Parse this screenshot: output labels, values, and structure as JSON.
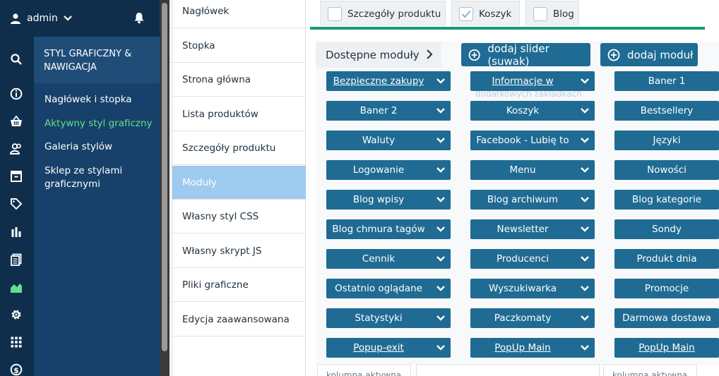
{
  "user": {
    "name": "admin"
  },
  "sidebar_icons": [
    "search-icon",
    "info-icon",
    "basket-icon",
    "users-icon",
    "box-icon",
    "tag-icon",
    "stats-icon",
    "pages-icon",
    "graphics-icon",
    "gear-icon",
    "apps-icon",
    "dollar-icon"
  ],
  "section": {
    "title": "STYL GRAFICZNY & NAWIGACJA",
    "items": [
      {
        "label": "Nagłówek i stopka",
        "active": false
      },
      {
        "label": "Aktywny styl graficzny",
        "active": true
      },
      {
        "label": "Galeria stylów",
        "active": false
      },
      {
        "label": "Sklep ze stylami graficznymi",
        "active": false
      }
    ]
  },
  "page_menu": [
    {
      "label": "Nagłówek",
      "active": false
    },
    {
      "label": "Stopka",
      "active": false
    },
    {
      "label": "Strona główna",
      "active": false
    },
    {
      "label": "Lista produktów",
      "active": false
    },
    {
      "label": "Szczegóły produktu",
      "active": false
    },
    {
      "label": "Moduły",
      "active": true
    },
    {
      "label": "Własny styl CSS",
      "active": false
    },
    {
      "label": "Własny skrypt JS",
      "active": false
    },
    {
      "label": "Pliki graficzne",
      "active": false
    },
    {
      "label": "Edycja zaawansowana",
      "active": false
    }
  ],
  "tabs": [
    {
      "label": "Szczegóły produktu",
      "checked": false
    },
    {
      "label": "Koszyk",
      "checked": true
    },
    {
      "label": "Blog",
      "checked": false
    }
  ],
  "available_modules_label": "Dostępne moduły",
  "actions": {
    "add_slider": "dodaj slider (suwak)",
    "add_module": "dodaj moduł"
  },
  "modules": {
    "col1": [
      {
        "label": "Bezpieczne zakupy",
        "underline": true
      },
      {
        "label": "Baner 2",
        "underline": false
      },
      {
        "label": "Waluty",
        "underline": false
      },
      {
        "label": "Logowanie",
        "underline": false
      },
      {
        "label": "Blog wpisy",
        "underline": false
      },
      {
        "label": "Blog chmura tagów",
        "underline": false
      },
      {
        "label": "Cennik",
        "underline": false
      },
      {
        "label": "Ostatnio oglądane",
        "underline": false
      },
      {
        "label": "Statystyki",
        "underline": false
      },
      {
        "label": "Popup-exit",
        "underline": true
      }
    ],
    "col2": [
      {
        "label": "Informacje w",
        "underline": true
      },
      {
        "label": "Koszyk",
        "underline": false
      },
      {
        "label": "Facebook - Lubię to",
        "underline": false
      },
      {
        "label": "Menu",
        "underline": false
      },
      {
        "label": "Blog archiwum",
        "underline": false
      },
      {
        "label": "Newsletter",
        "underline": false
      },
      {
        "label": "Producenci",
        "underline": false
      },
      {
        "label": "Wyszukiwarka",
        "underline": false
      },
      {
        "label": "Paczkomaty",
        "underline": false
      },
      {
        "label": "PopUp Main",
        "underline": true
      }
    ],
    "col3": [
      {
        "label": "Baner 1",
        "underline": false
      },
      {
        "label": "Bestsellery",
        "underline": false
      },
      {
        "label": "Języki",
        "underline": false
      },
      {
        "label": "Nowości",
        "underline": false
      },
      {
        "label": "Blog kategorie",
        "underline": false
      },
      {
        "label": "Sondy",
        "underline": false
      },
      {
        "label": "Produkt dnia",
        "underline": false
      },
      {
        "label": "Promocje",
        "underline": false
      },
      {
        "label": "Darmowa dostawa",
        "underline": false
      },
      {
        "label": "PopUp Main",
        "underline": true
      }
    ]
  },
  "ghost_text": "dodatkowych zakładkach",
  "column_labels": [
    "kolumna aktywna",
    "kolumna aktywna"
  ],
  "colors": {
    "brand_dark": "#0f2e4c",
    "module_blue": "#1f6b93",
    "accent_green": "#179b78",
    "active_menu": "#9fcaf0"
  }
}
